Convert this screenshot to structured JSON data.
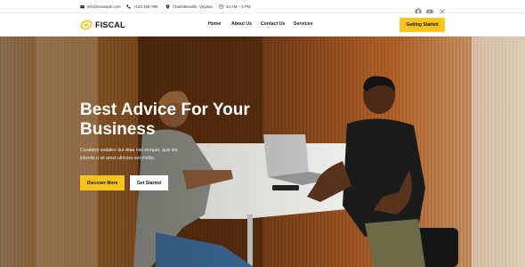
{
  "topbar": {
    "email": "info@example.com",
    "phone": "+123 456 789",
    "location": "Charlottesville, Virginia",
    "hours": "10 AM – 5 PM",
    "social_icons": [
      "facebook-icon",
      "youtube-icon",
      "x-twitter-icon"
    ]
  },
  "header": {
    "logo_text": "FISCAL",
    "nav": [
      "Home",
      "About Us",
      "Contact Us",
      "Services"
    ],
    "cta_label": "Getting Started"
  },
  "hero": {
    "title": "Best Advice For Your Business",
    "text": "Curabitur sodales dui vitae nisi semper, quis les lobortis n sit amet ultricies est mollis.",
    "primary_button": "Discover More",
    "secondary_button": "Get Started"
  },
  "colors": {
    "accent": "#f9c31f",
    "text_dark": "#1c1c1c",
    "white": "#ffffff"
  }
}
